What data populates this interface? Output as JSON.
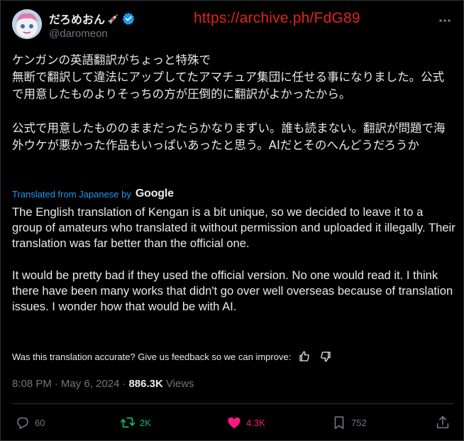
{
  "author": {
    "display_name": "だろめおん",
    "handle": "@daromeon",
    "verified": true
  },
  "overlay": {
    "archive_link": "https://archive.ph/FdG89"
  },
  "post": {
    "japanese_text": "ケンガンの英語翻訳がちょっと特殊で\n無断で翻訳して違法にアップしてたアマチュア集団に任せる事になりました。公式で用意したものよりそっちの方が圧倒的に翻訳がよかったから。\n\n公式で用意したもののままだったらかなりまずい。誰も読まない。翻訳が問題で海外ウケが悪かった作品もいっぱいあったと思う。AIだとそのへんどうだろうか",
    "translated_from_label": "Translated from Japanese by",
    "translator": "Google",
    "english_text": "The English translation of Kengan is a bit unique, so we decided to leave it to a group of amateurs who translated it without permission and uploaded it illegally. Their translation was far better than the official one.\n\nIt would be pretty bad if they used the official version. No one would read it. I think there have been many works that didn't go over well overseas because of translation issues. I wonder how that would be with AI.",
    "feedback_prompt": "Was this translation accurate? Give us feedback so we can improve:",
    "time": "8:08 PM",
    "separator": "·",
    "date": "May 6, 2024",
    "views_count": "886.3K",
    "views_label": "Views"
  },
  "actions": {
    "replies": "60",
    "reposts": "2K",
    "likes": "4.3K",
    "bookmarks": "752"
  },
  "colors": {
    "background": "#000000",
    "text": "#e7e9ea",
    "muted": "#71767b",
    "accent_blue": "#1d9bf0",
    "repost_green": "#00ba7c",
    "like_pink": "#f91880",
    "overlay_red": "#e0241b"
  },
  "icons": {
    "verified": "verified-badge-icon",
    "more": "more-horizontal-icon",
    "thumb_up": "thumbs-up-icon",
    "thumb_down": "thumbs-down-icon",
    "reply": "reply-icon",
    "repost": "repost-icon",
    "like": "heart-icon",
    "bookmark": "bookmark-icon",
    "share": "share-icon"
  }
}
